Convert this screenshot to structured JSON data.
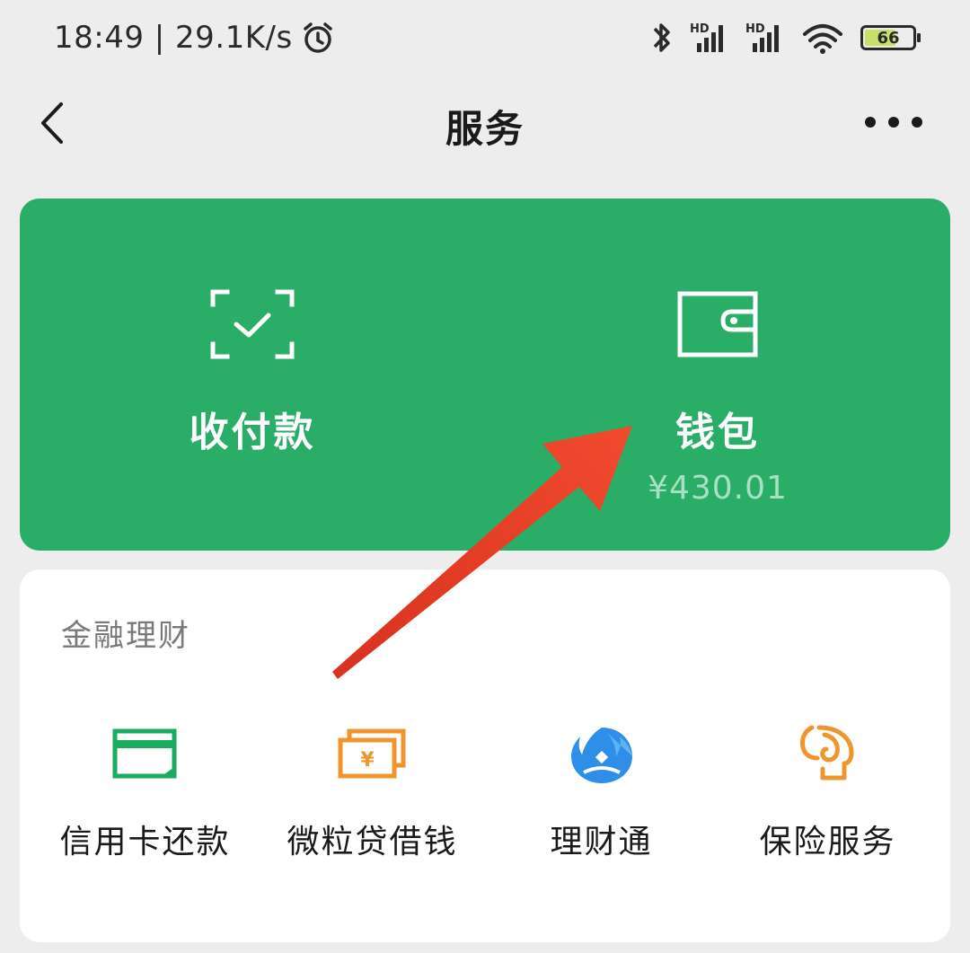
{
  "status_bar": {
    "time_speed": "18:49 | 29.1K/s",
    "battery_level": "66",
    "icons": [
      "alarm-icon",
      "bluetooth-icon",
      "signal-hd-icon",
      "signal-hd-icon",
      "wifi-icon",
      "battery-icon"
    ]
  },
  "nav": {
    "title": "服务",
    "back_icon": "chevron-left-icon",
    "more_icon": "more-dots-icon"
  },
  "main_card": {
    "background": "#2aae67",
    "pay": {
      "label": "收付款",
      "icon": "scan-check-icon"
    },
    "wallet": {
      "label": "钱包",
      "balance": "¥430.01",
      "icon": "wallet-icon"
    }
  },
  "finance": {
    "title": "金融理财",
    "items": [
      {
        "label": "信用卡还款",
        "icon": "credit-card-icon",
        "color": "#1aad5f"
      },
      {
        "label": "微粒贷借钱",
        "icon": "cash-loan-icon",
        "color": "#f0952d"
      },
      {
        "label": "理财通",
        "icon": "licaitong-icon",
        "color": "#2e8ee8"
      },
      {
        "label": "保险服务",
        "icon": "insurance-icon",
        "color": "#f0952d"
      }
    ]
  },
  "annotation": {
    "color": "#e8382a",
    "icon": "red-arrow"
  }
}
